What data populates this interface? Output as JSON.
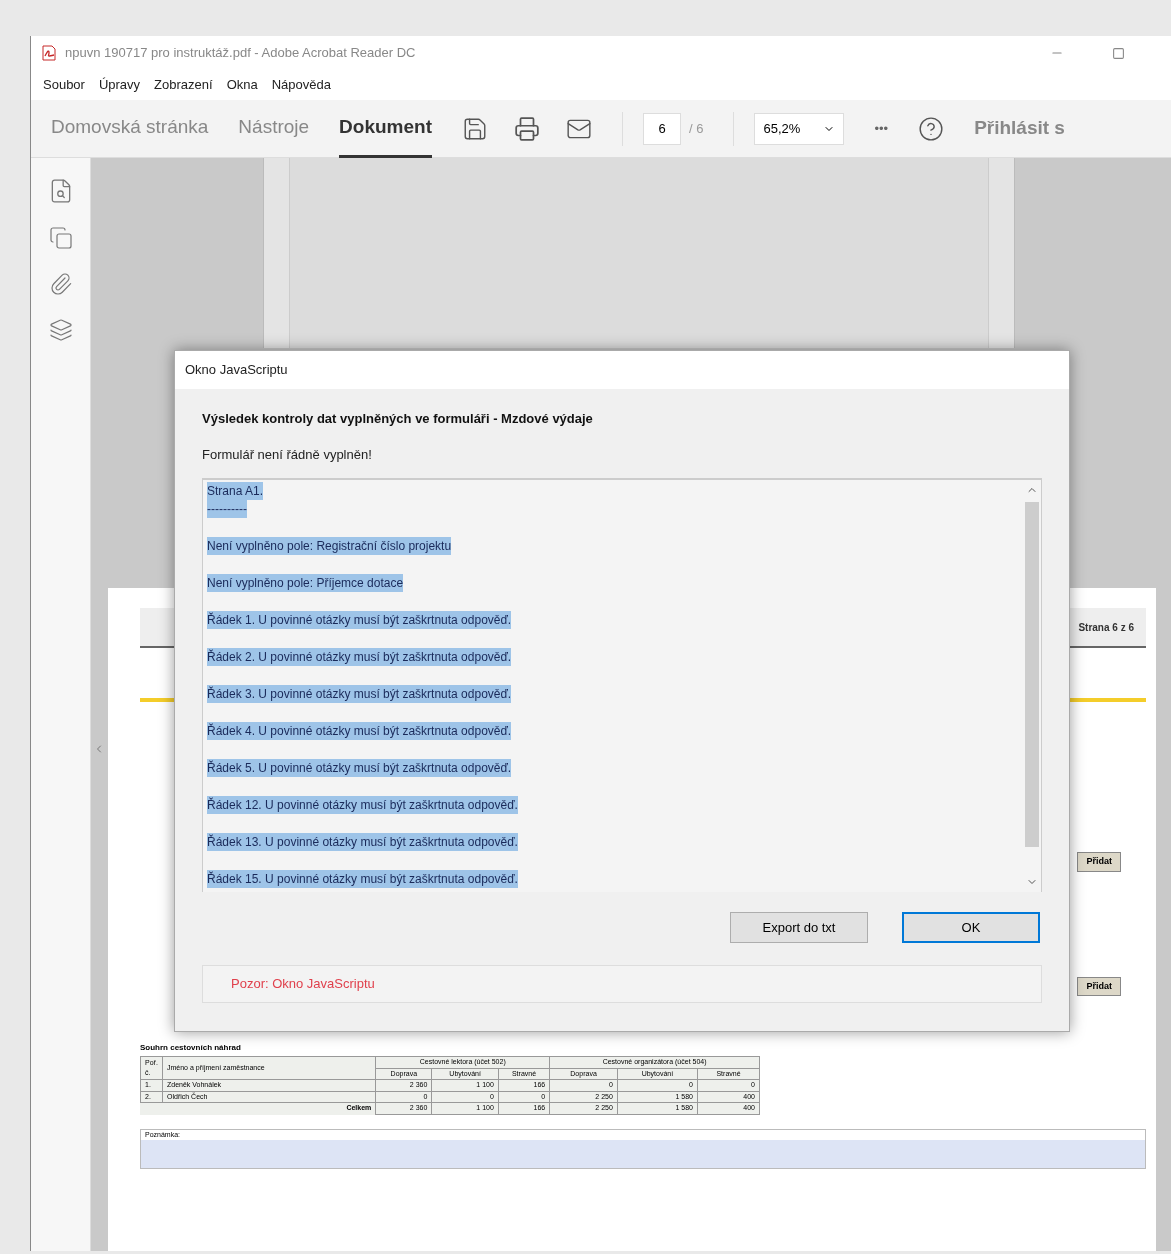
{
  "window": {
    "title": "npuvn 190717 pro instruktáž.pdf - Adobe Acrobat Reader DC"
  },
  "menu": [
    "Soubor",
    "Úpravy",
    "Zobrazení",
    "Okna",
    "Nápověda"
  ],
  "tabs": [
    {
      "label": "Domovská stránka",
      "selected": false
    },
    {
      "label": "Nástroje",
      "selected": false
    },
    {
      "label": "Dokument",
      "selected": true
    }
  ],
  "toolbar": {
    "page": "6",
    "page_total": "/ 6",
    "zoom": "65,2%",
    "more": "•••",
    "sign_in": "Přihlásit s"
  },
  "document": {
    "page_label": "Strana 6 z 6",
    "add_buttons": [
      "Přidat",
      "Přidat"
    ],
    "table": {
      "title": "Souhrn cestovních náhrad",
      "col_no": "Poř. č.",
      "col_name": "Jméno a příjmení zaměstnance",
      "groups": [
        "Cestovné lektora (účet 502)",
        "Cestovné organizátora (účet 504)"
      ],
      "subcols": [
        "Doprava",
        "Ubytování",
        "Stravné",
        "Doprava",
        "Ubytování",
        "Stravné"
      ],
      "rows": [
        {
          "no": "1.",
          "name": "Zdeněk Vohnálek",
          "values": [
            "2 360",
            "1 100",
            "166",
            "0",
            "0",
            "0"
          ]
        },
        {
          "no": "2.",
          "name": "Oldřich Čech",
          "values": [
            "0",
            "0",
            "0",
            "2 250",
            "1 580",
            "400"
          ]
        }
      ],
      "total_label": "Celkem",
      "totals": [
        "2 360",
        "1 100",
        "166",
        "2 250",
        "1 580",
        "400"
      ]
    },
    "note_label": "Poznámka:"
  },
  "dialog": {
    "title": "Okno JavaScriptu",
    "heading": "Výsledek kontroly dat vyplněných ve formuláři - Mzdové výdaje",
    "message": "Formulář není řádně vyplněn!",
    "text_selected": true,
    "lines": [
      "Strana A1.",
      "----------",
      "Není vyplněno pole: Registrační číslo projektu",
      "Není vyplněno pole: Příjemce dotace",
      "Řádek 1. U povinné otázky musí být zaškrtnuta odpověď.",
      "Řádek 2. U povinné otázky musí být zaškrtnuta odpověď.",
      "Řádek 3. U povinné otázky musí být zaškrtnuta odpověď.",
      "Řádek 4. U povinné otázky musí být zaškrtnuta odpověď.",
      "Řádek 5. U povinné otázky musí být zaškrtnuta odpověď.",
      "Řádek 12. U povinné otázky musí být zaškrtnuta odpověď.",
      "Řádek 13. U povinné otázky musí být zaškrtnuta odpověď.",
      "Řádek 15. U povinné otázky musí být zaškrtnuta odpověď."
    ],
    "buttons": [
      {
        "label": "Export do txt",
        "default": false
      },
      {
        "label": "OK",
        "default": true
      }
    ],
    "warning": "Pozor: Okno JavaScriptu"
  }
}
